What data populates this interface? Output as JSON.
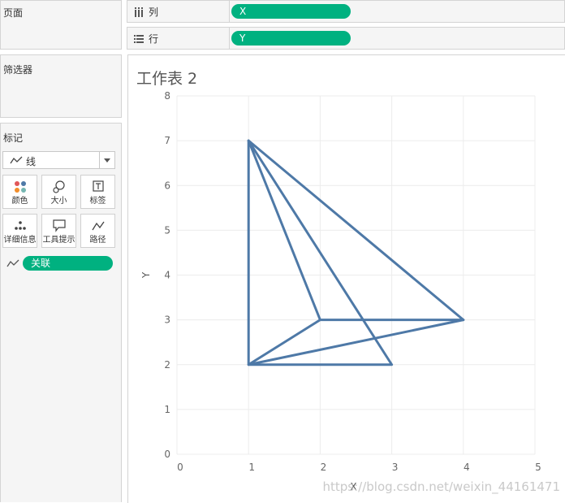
{
  "left_panel": {
    "pages_title": "页面",
    "filters_title": "筛选器",
    "marks_title": "标记",
    "mark_type": "线",
    "mark_buttons": [
      {
        "label": "颜色",
        "icon": "color-dots-icon"
      },
      {
        "label": "大小",
        "icon": "size-icon"
      },
      {
        "label": "标签",
        "icon": "label-icon"
      },
      {
        "label": "详细信息",
        "icon": "detail-icon"
      },
      {
        "label": "工具提示",
        "icon": "tooltip-icon"
      },
      {
        "label": "路径",
        "icon": "path-icon"
      }
    ],
    "path_field": "关联"
  },
  "shelves": {
    "columns_label": "列",
    "columns_pill": "X",
    "rows_label": "行",
    "rows_pill": "Y"
  },
  "worksheet": {
    "title": "工作表 2"
  },
  "colors": {
    "pill": "#00b180",
    "line": "#4e79a7"
  },
  "chart_data": {
    "type": "line",
    "xlabel": "X",
    "ylabel": "Y",
    "xlim": [
      0,
      5
    ],
    "ylim": [
      0,
      8
    ],
    "x_ticks": [
      "0",
      "1",
      "2",
      "3",
      "4",
      "5"
    ],
    "y_ticks": [
      "0",
      "1",
      "2",
      "3",
      "4",
      "5",
      "6",
      "7",
      "8"
    ],
    "grid": true,
    "series": [
      {
        "points": [
          [
            1,
            7
          ],
          [
            4,
            3
          ],
          [
            1,
            2
          ],
          [
            1,
            7
          ]
        ]
      },
      {
        "points": [
          [
            1,
            7
          ],
          [
            2,
            3
          ],
          [
            4,
            3
          ]
        ]
      },
      {
        "points": [
          [
            1,
            7
          ],
          [
            3,
            2
          ],
          [
            1,
            2
          ],
          [
            2,
            3
          ]
        ]
      }
    ]
  },
  "watermark": "https://blog.csdn.net/weixin_44161471"
}
